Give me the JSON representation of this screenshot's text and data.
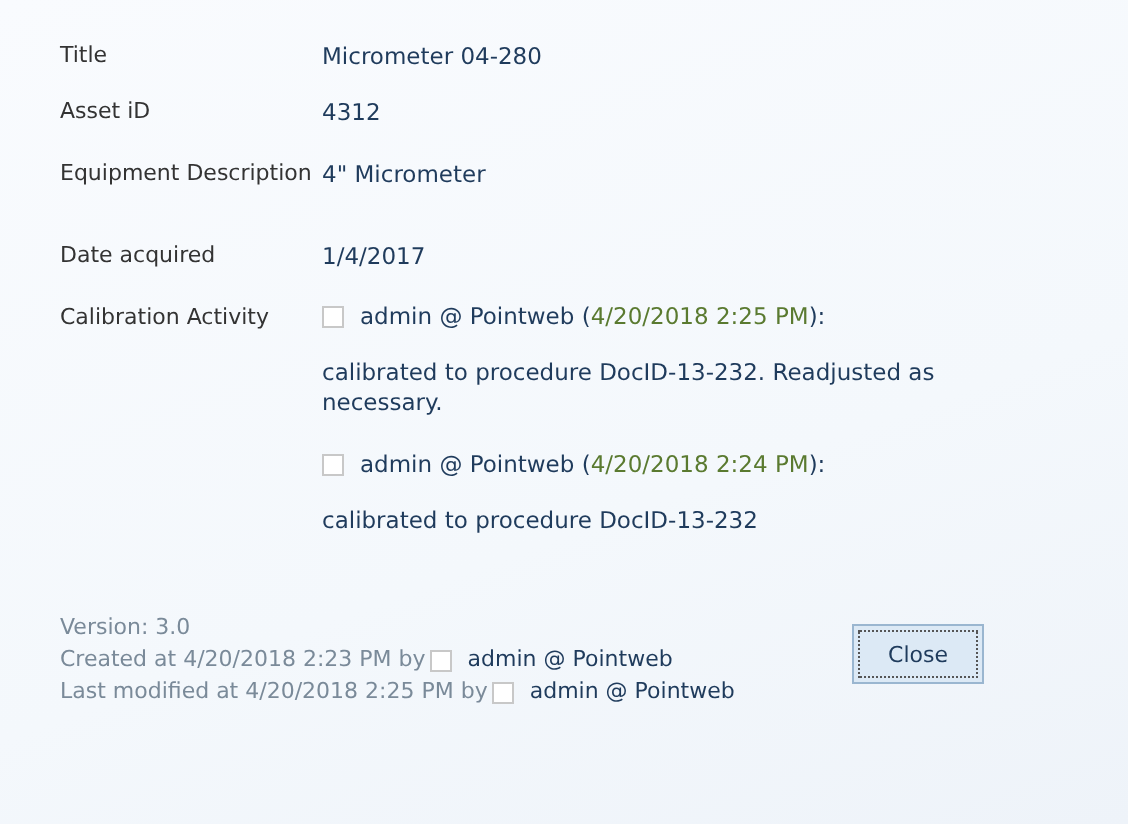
{
  "fields": [
    {
      "label": "Title",
      "value": "Micrometer 04-280"
    },
    {
      "label": "Asset iD",
      "value": "4312"
    },
    {
      "label": "Equipment Description",
      "value": "4\" Micrometer"
    },
    {
      "label": "Date acquired",
      "value": "1/4/2017"
    }
  ],
  "calibration": {
    "label": "Calibration Activity",
    "entries": [
      {
        "user": "admin @ Pointweb",
        "open": "(",
        "time": "4/20/2018 2:25 PM",
        "close": "):",
        "text": "calibrated to procedure DocID-13-232.  Readjusted as necessary."
      },
      {
        "user": "admin @ Pointweb",
        "open": "(",
        "time": "4/20/2018 2:24 PM",
        "close": "):",
        "text": "calibrated to procedure DocID-13-232"
      }
    ]
  },
  "footer": {
    "version": "Version: 3.0",
    "created": {
      "text": "Created at 4/20/2018 2:23 PM  by",
      "user": "admin @ Pointweb"
    },
    "modified": {
      "text": "Last modified at 4/20/2018 2:25 PM  by",
      "user": "admin @ Pointweb"
    }
  },
  "close_button": "Close"
}
